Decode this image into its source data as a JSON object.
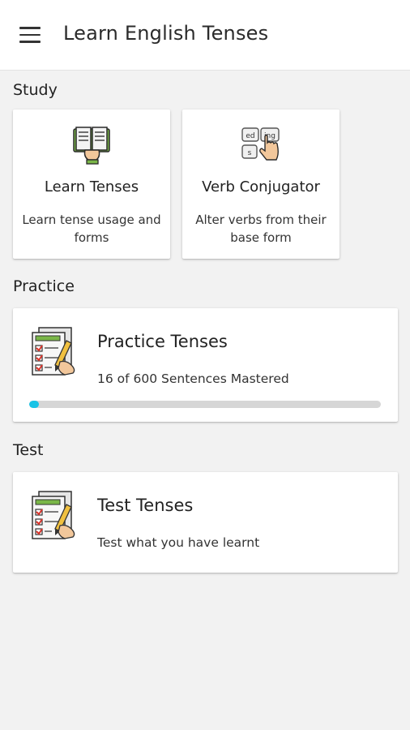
{
  "app_bar": {
    "title": "Learn English Tenses",
    "menu_icon": "hamburger-menu-icon"
  },
  "study": {
    "label": "Study",
    "cards": [
      {
        "title": "Learn Tenses",
        "description": "Learn tense usage and forms",
        "icon": "open-book-icon"
      },
      {
        "title": "Verb Conjugator",
        "description": "Alter verbs from their base form",
        "icon": "verb-tiles-tap-icon"
      }
    ]
  },
  "practice": {
    "label": "Practice",
    "card": {
      "title": "Practice Tenses",
      "subtitle": "16 of 600 Sentences Mastered",
      "progress": 0.0267,
      "icon": "checklist-pencil-icon"
    }
  },
  "test": {
    "label": "Test",
    "card": {
      "title": "Test Tenses",
      "subtitle": "Test what you have learnt",
      "icon": "checklist-pencil-icon"
    }
  },
  "colors": {
    "app_bar_bg": "#ffffff",
    "page_bg": "#f2f2f2",
    "progress_fill": "#19c3e6",
    "progress_track": "#d6d6d6"
  }
}
